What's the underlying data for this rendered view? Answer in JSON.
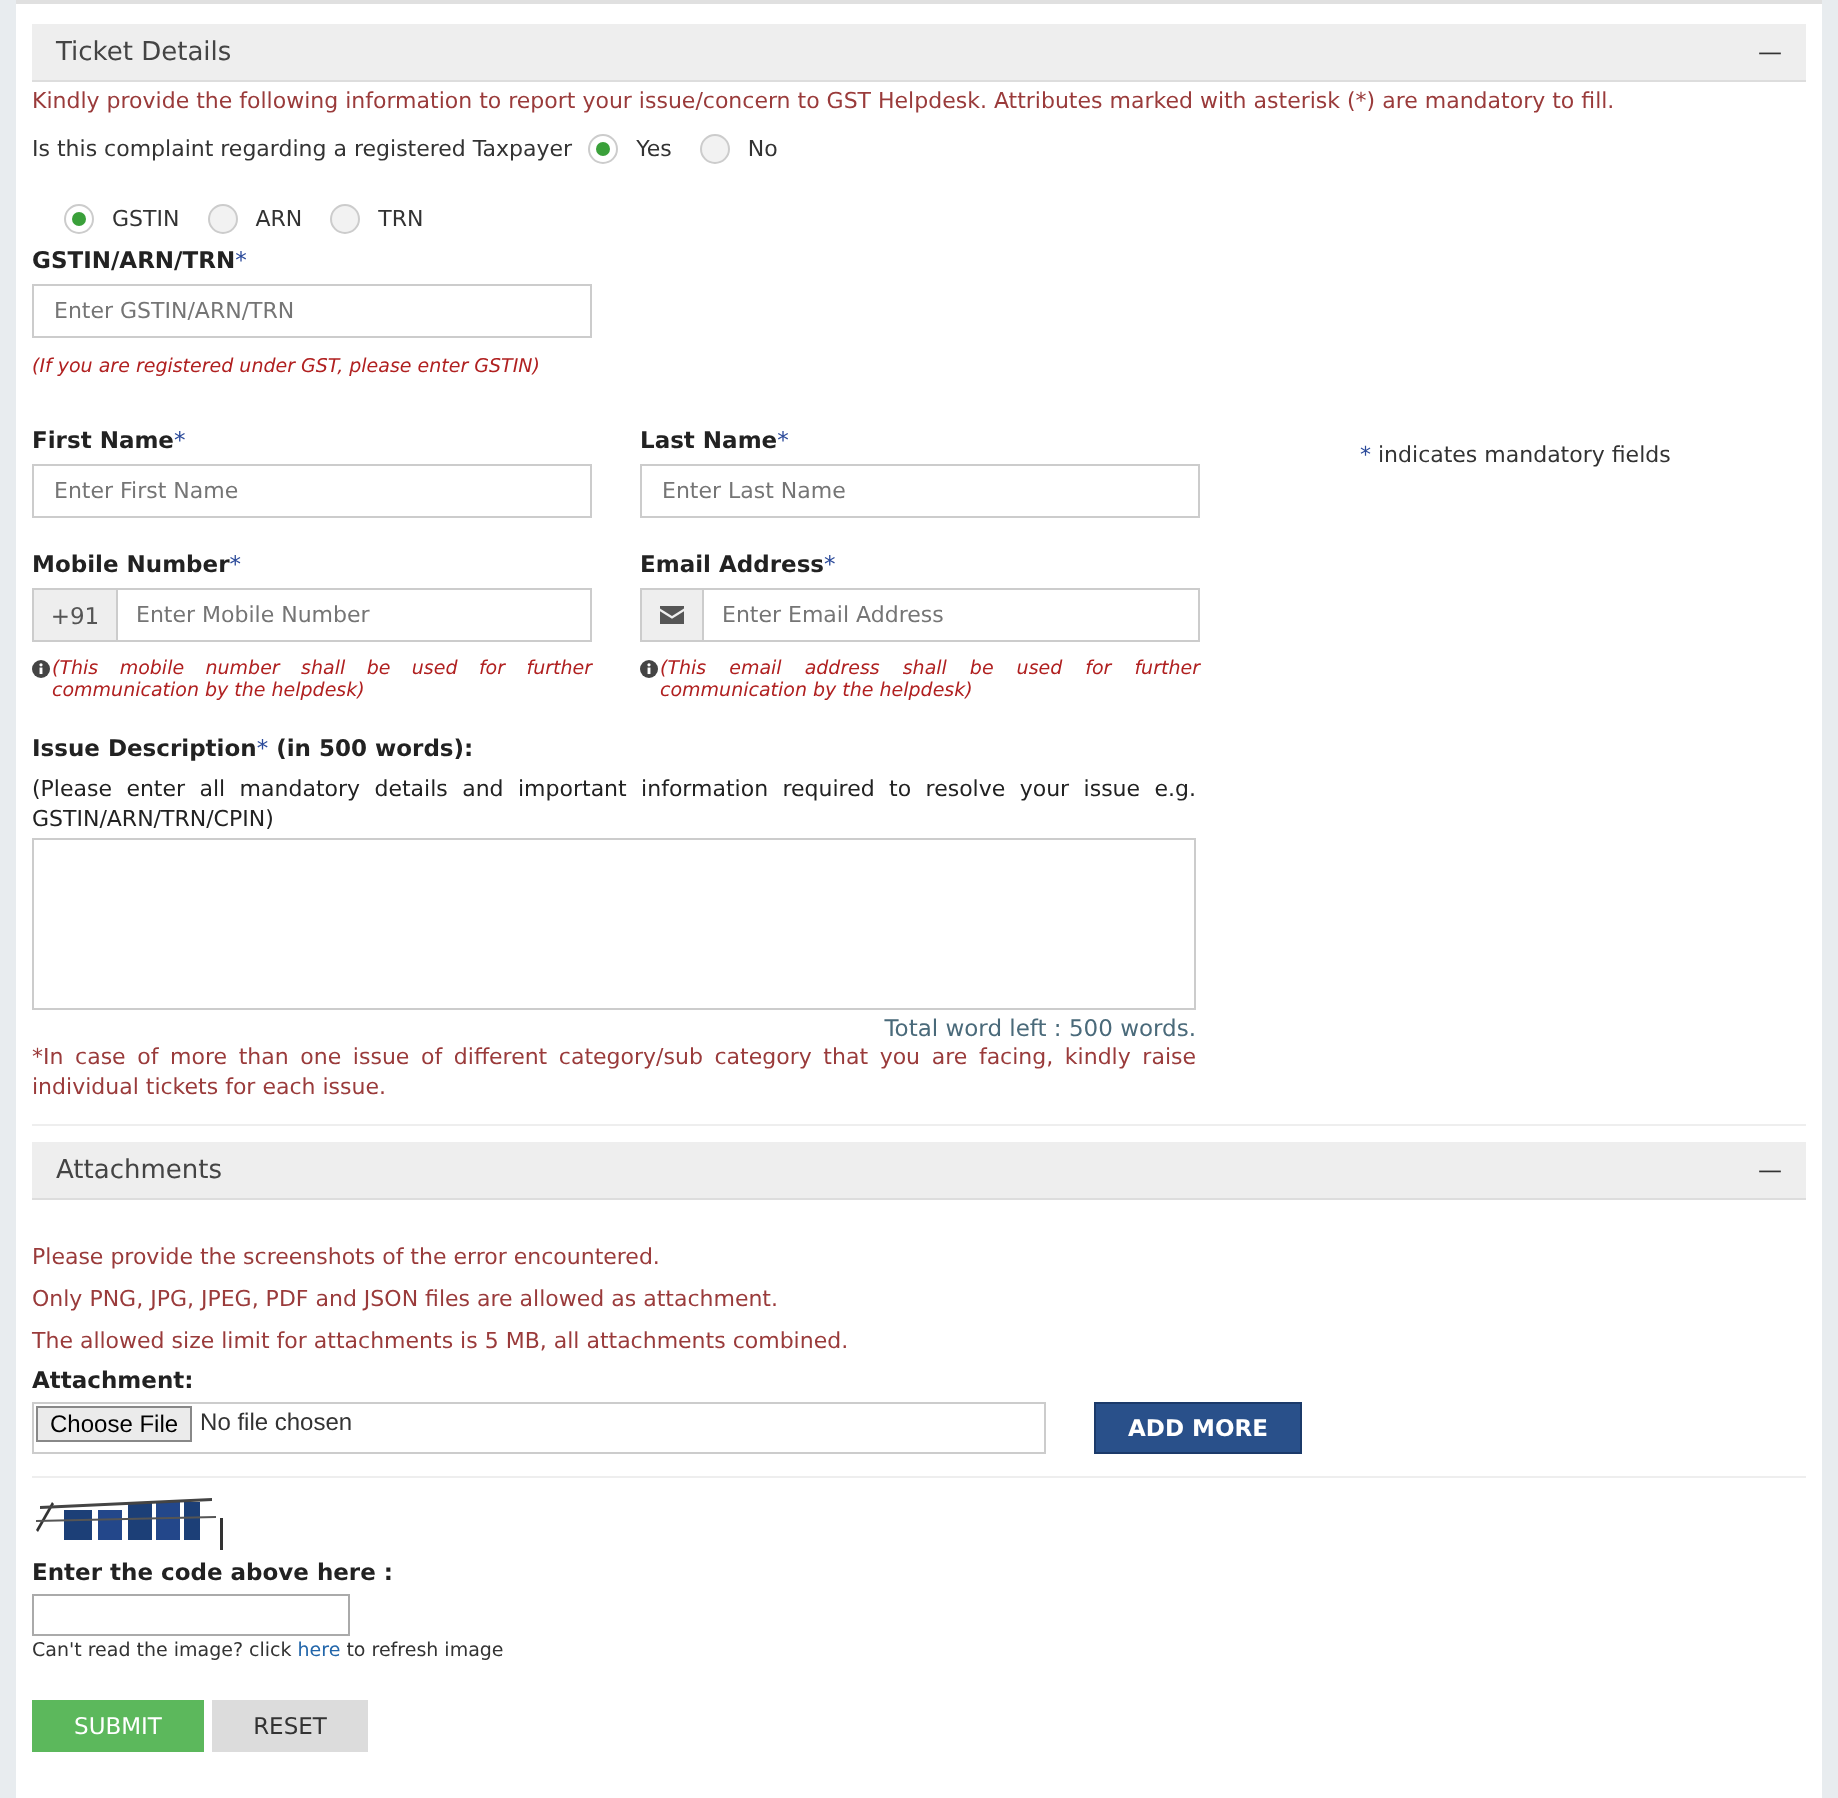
{
  "ticket_details": {
    "title": "Ticket Details",
    "collapse": "—",
    "intro": "Kindly provide the following information to report your issue/concern to GST Helpdesk. Attributes marked with asterisk (*) are mandatory to fill.",
    "taxpayer_question": {
      "label": "Is this complaint regarding a registered Taxpayer",
      "options": [
        {
          "label": "Yes",
          "selected": true
        },
        {
          "label": "No",
          "selected": false
        }
      ]
    },
    "id_type": {
      "options": [
        {
          "label": "GSTIN",
          "selected": true
        },
        {
          "label": "ARN",
          "selected": false
        },
        {
          "label": "TRN",
          "selected": false
        }
      ]
    },
    "id_field": {
      "label": "GSTIN/ARN/TRN",
      "asterisk": "*",
      "placeholder": "Enter GSTIN/ARN/TRN",
      "hint": "(If you are registered under GST, please enter GSTIN)"
    },
    "first_name": {
      "label": "First Name",
      "asterisk": "*",
      "placeholder": "Enter First Name"
    },
    "last_name": {
      "label": "Last Name",
      "asterisk": "*",
      "placeholder": "Enter Last Name"
    },
    "mandatory_note": {
      "asterisk": "*",
      "text": "indicates mandatory fields"
    },
    "mobile": {
      "label": "Mobile Number",
      "asterisk": "*",
      "prefix": "+91",
      "placeholder": "Enter Mobile Number",
      "note": "(This mobile number shall be used for further communication by the helpdesk)"
    },
    "email": {
      "label": "Email Address",
      "asterisk": "*",
      "placeholder": "Enter Email Address",
      "note": "(This email address shall be used for further communication by the helpdesk)"
    },
    "issue": {
      "label": "Issue Description",
      "asterisk": "*",
      "suffix": " (in 500 words):",
      "instructions": "(Please enter all mandatory details and important information required to resolve your issue e.g. GSTIN/ARN/TRN/CPIN)",
      "word_count": "Total word left : 500 words.",
      "footnote": "*In case of more than one issue of different category/sub category that you are facing, kindly raise individual tickets for each issue."
    }
  },
  "attachments": {
    "title": "Attachments",
    "collapse": "—",
    "notes": [
      "Please provide the screenshots of the error encountered.",
      "Only PNG, JPG, JPEG, PDF and JSON files are allowed as attachment.",
      "The allowed size limit for attachments is 5 MB, all attachments combined."
    ],
    "label": "Attachment:",
    "choose_button": "Choose File",
    "file_status": "No file chosen",
    "add_more": "ADD MORE"
  },
  "captcha": {
    "label": "Enter the code above here :",
    "hint_before": "Can't read the image? click",
    "link": "here",
    "hint_after": "to refresh image"
  },
  "buttons": [
    {
      "kind": "submit",
      "label": "SUBMIT"
    },
    {
      "kind": "reset",
      "label": "RESET"
    }
  ]
}
